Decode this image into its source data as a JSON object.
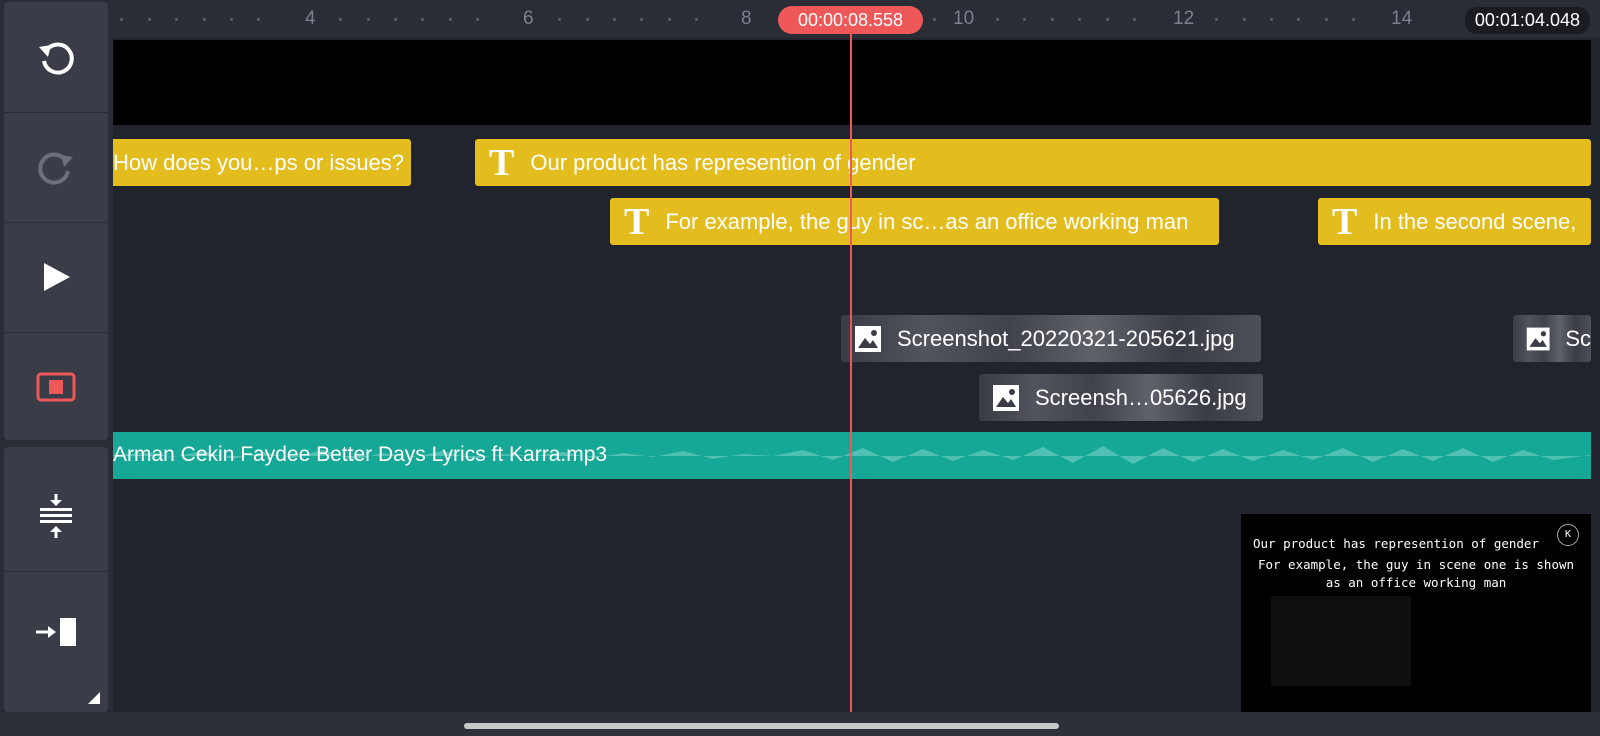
{
  "sidebar": {
    "undo": "undo-icon",
    "redo": "redo-icon",
    "play": "play-icon",
    "preview": "preview-icon",
    "fit": "fit-icon",
    "goto_end": "goto-end-icon"
  },
  "ruler": {
    "ticks": [
      "4",
      "6",
      "8",
      "10",
      "12",
      "14"
    ],
    "playhead_time": "00:00:08.558",
    "total_duration": "00:01:04.048"
  },
  "tracks": {
    "text_clips": [
      {
        "label": "How does you…ps or issues?"
      },
      {
        "label": "Our product has represention of gender"
      },
      {
        "label": "For example, the guy in sc…as an office working man"
      },
      {
        "label": "In the second scene,"
      }
    ],
    "image_clips": [
      {
        "label": "Screenshot_20220321-205621.jpg"
      },
      {
        "label": "Screensh…05626.jpg"
      },
      {
        "label": "Sc"
      }
    ],
    "audio_clip": {
      "label": "Arman Cekin  Faydee  Better Days Lyrics ft Karra.mp3"
    }
  },
  "preview": {
    "line1": "Our product has represention of gender",
    "line2": "For example, the guy in scene one is shown",
    "line3": "as an office working man"
  },
  "colors": {
    "accent": "#ee5858",
    "text_clip": "#e3bc1e",
    "audio_clip": "#16a896"
  }
}
